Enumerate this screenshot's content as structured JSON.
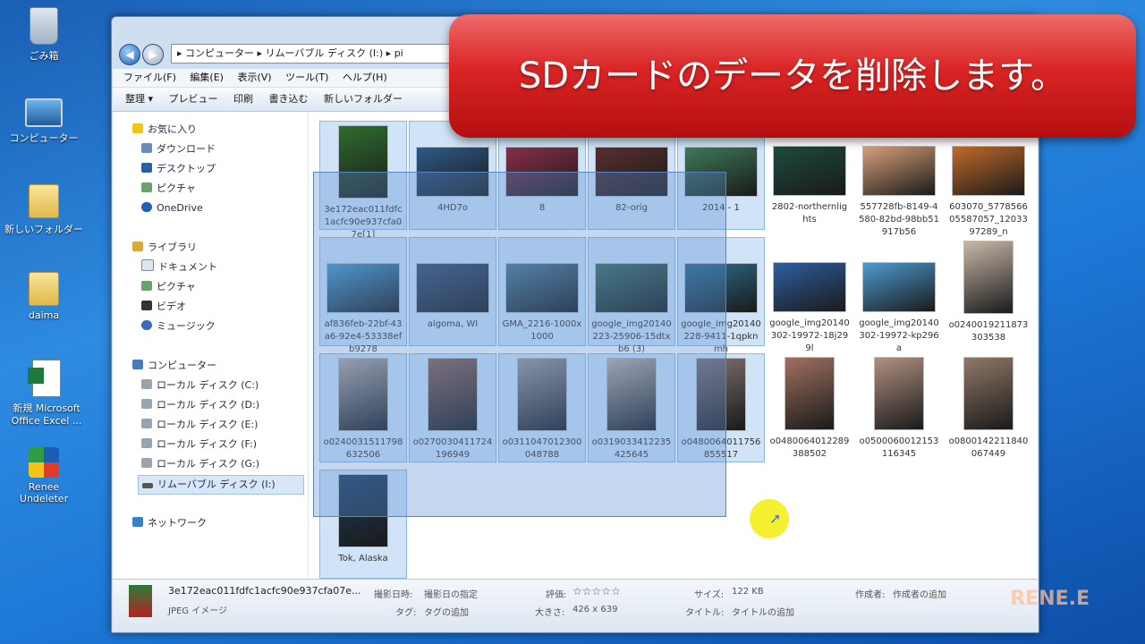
{
  "desktop": {
    "icons": [
      {
        "label": "ごみ箱",
        "icon": "recycle-bin-icon"
      },
      {
        "label": "コンピューター",
        "icon": "computer-icon"
      },
      {
        "label": "新しいフォルダー",
        "icon": "folder-icon"
      },
      {
        "label": "daima",
        "icon": "folder-icon"
      },
      {
        "label": "新規 Microsoft Office Excel ...",
        "icon": "excel-file-icon"
      },
      {
        "label": "Renee Undeleter",
        "icon": "renee-app-icon"
      }
    ]
  },
  "explorer": {
    "address": "▸ コンピューター ▸ リムーバブル ディスク (I:) ▸ pi",
    "menu": [
      "ファイル(F)",
      "編集(E)",
      "表示(V)",
      "ツール(T)",
      "ヘルプ(H)"
    ],
    "toolbar": [
      "整理 ▾",
      "プレビュー",
      "印刷",
      "書き込む",
      "新しいフォルダー"
    ],
    "nav": {
      "favorites": "お気に入り",
      "fav_items": [
        "ダウンロード",
        "デスクトップ",
        "ピクチャ",
        "OneDrive"
      ],
      "libraries": "ライブラリ",
      "lib_items": [
        "ドキュメント",
        "ピクチャ",
        "ビデオ",
        "ミュージック"
      ],
      "computer": "コンピューター",
      "drives": [
        "ローカル ディスク (C:)",
        "ローカル ディスク (D:)",
        "ローカル ディスク (E:)",
        "ローカル ディスク (F:)",
        "ローカル ディスク (G:)",
        "リムーバブル ディスク (I:)"
      ],
      "network": "ネットワーク"
    },
    "files": [
      {
        "name": "3e172eac011fdfc1acfc90e937cfa07e[1]",
        "selected": true,
        "color": "#2f6d2f"
      },
      {
        "name": "4HD7o",
        "selected": true,
        "color": "#2e5a8a"
      },
      {
        "name": "8",
        "selected": true,
        "color": "#8a2e4a"
      },
      {
        "name": "82-orig",
        "selected": true,
        "color": "#5a2e2e"
      },
      {
        "name": "2014 - 1",
        "selected": true,
        "color": "#3e7a5a"
      },
      {
        "name": "2802-northernlights",
        "selected": false,
        "color": "#1e4a3e"
      },
      {
        "name": "557728fb-8149-4580-82bd-98bb51917b56",
        "selected": false,
        "color": "#d9a07a"
      },
      {
        "name": "603070_577856605587057_1203397289_n",
        "selected": false,
        "color": "#c26a2a"
      },
      {
        "name": "af836feb-22bf-43a6-92e4-53338efb9278",
        "selected": true,
        "color": "#4a9ac8"
      },
      {
        "name": "algoma, WI",
        "selected": true,
        "color": "#3a4e6e"
      },
      {
        "name": "GMA_2216-1000x1000",
        "selected": true,
        "color": "#4e7a8e"
      },
      {
        "name": "google_img20140223-25906-15dtxb6 (3)",
        "selected": true,
        "color": "#3e6e5e"
      },
      {
        "name": "google_img20140228-9411-1qpknmh",
        "selected": true,
        "color": "#2e6e8e"
      },
      {
        "name": "google_img20140302-19972-18j299l",
        "selected": false,
        "color": "#2e5e9e"
      },
      {
        "name": "google_img20140302-19972-kp296a",
        "selected": false,
        "color": "#4e9ad0"
      },
      {
        "name": "o0240019211873303538",
        "selected": false,
        "color": "#c8b8a8"
      },
      {
        "name": "o0240031511798632506",
        "selected": true,
        "color": "#b8a8a0"
      },
      {
        "name": "o0270030411724196949",
        "selected": true,
        "color": "#8e6050"
      },
      {
        "name": "o0311047012300048788",
        "selected": true,
        "color": "#a09890"
      },
      {
        "name": "o0319033412235425645",
        "selected": true,
        "color": "#c0b0a0"
      },
      {
        "name": "o0480064011756855517",
        "selected": true,
        "color": "#807070"
      },
      {
        "name": "o0480064012289388502",
        "selected": false,
        "color": "#a07060"
      },
      {
        "name": "o0500060012153116345",
        "selected": false,
        "color": "#b09080"
      },
      {
        "name": "o0800142211840067449",
        "selected": false,
        "color": "#907868"
      },
      {
        "name": "Tok, Alaska",
        "selected": true,
        "color": "#1e3e5e"
      }
    ],
    "status": {
      "filename": "3e172eac011fdfc1acfc90e937cfa07e...",
      "filetype": "JPEG イメージ",
      "date_label": "撮影日時:",
      "date_value": "撮影日の指定",
      "tag_label": "タグ:",
      "tag_value": "タグの追加",
      "rating_label": "評価:",
      "rating_value": "☆☆☆☆☆",
      "dim_label": "大きさ:",
      "dim_value": "426 x 639",
      "size_label": "サイズ:",
      "size_value": "122 KB",
      "title_label": "タイトル:",
      "title_value": "タイトルの追加",
      "author_label": "作成者:",
      "author_value": "作成者の追加"
    }
  },
  "banner": {
    "text": "SDカードのデータを削除します。"
  },
  "watermark": "RENE.E"
}
